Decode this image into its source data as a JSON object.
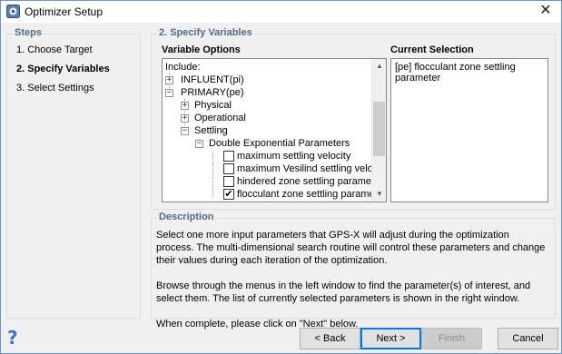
{
  "window": {
    "title": "Optimizer Setup",
    "close_label": "✕"
  },
  "steps": {
    "title": "Steps",
    "items": [
      {
        "label": "1. Choose Target",
        "active": false
      },
      {
        "label": "2. Specify Variables",
        "active": true
      },
      {
        "label": "3. Select Settings",
        "active": false
      }
    ]
  },
  "variables": {
    "title": "2. Specify Variables",
    "options_label": "Variable Options",
    "selection_label": "Current Selection",
    "tree": [
      {
        "label": "Include:",
        "level": 0,
        "toggle": "",
        "checkbox": null
      },
      {
        "label": "INFLUENT(pi)",
        "level": 1,
        "toggle": "+",
        "checkbox": null
      },
      {
        "label": "PRIMARY(pe)",
        "level": 1,
        "toggle": "-",
        "checkbox": null
      },
      {
        "label": "Physical",
        "level": 2,
        "toggle": "+",
        "checkbox": null
      },
      {
        "label": "Operational",
        "level": 2,
        "toggle": "+",
        "checkbox": null
      },
      {
        "label": "Settling",
        "level": 2,
        "toggle": "-",
        "checkbox": null
      },
      {
        "label": "Double Exponential Parameters",
        "level": 3,
        "toggle": "-",
        "checkbox": null
      },
      {
        "label": "maximum settling velocity",
        "level": 4,
        "toggle": "",
        "checkbox": false
      },
      {
        "label": "maximum Vesilind settling velocity",
        "level": 4,
        "toggle": "",
        "checkbox": false
      },
      {
        "label": "hindered zone settling parameter",
        "level": 4,
        "toggle": "",
        "checkbox": false
      },
      {
        "label": "flocculant zone settling parameter",
        "level": 4,
        "toggle": "",
        "checkbox": true
      }
    ],
    "current_selection": "[pe] flocculant zone settling parameter"
  },
  "description": {
    "title": "Description",
    "paragraphs": [
      "Select one more input parameters that GPS-X will adjust during the optimization process. The multi-dimensional search routine will control these parameters and change their values during each iteration of the optimization.",
      "Browse through the menus in the left window to find the parameter(s) of interest, and select them. The list of currently selected parameters is shown in the right window.",
      "When complete, please click on \"Next\" below."
    ]
  },
  "buttons": {
    "back": "< Back",
    "next": "Next >",
    "finish": "Finish",
    "cancel": "Cancel"
  },
  "icons": {
    "help": "?",
    "check": "✔",
    "plus": "+",
    "minus": "−",
    "arrow_up": "▲",
    "arrow_down": "▼"
  },
  "colors": {
    "group_title": "#4f6b8a",
    "help_icon": "#3a73c9",
    "default_button_border": "#0078d7"
  }
}
